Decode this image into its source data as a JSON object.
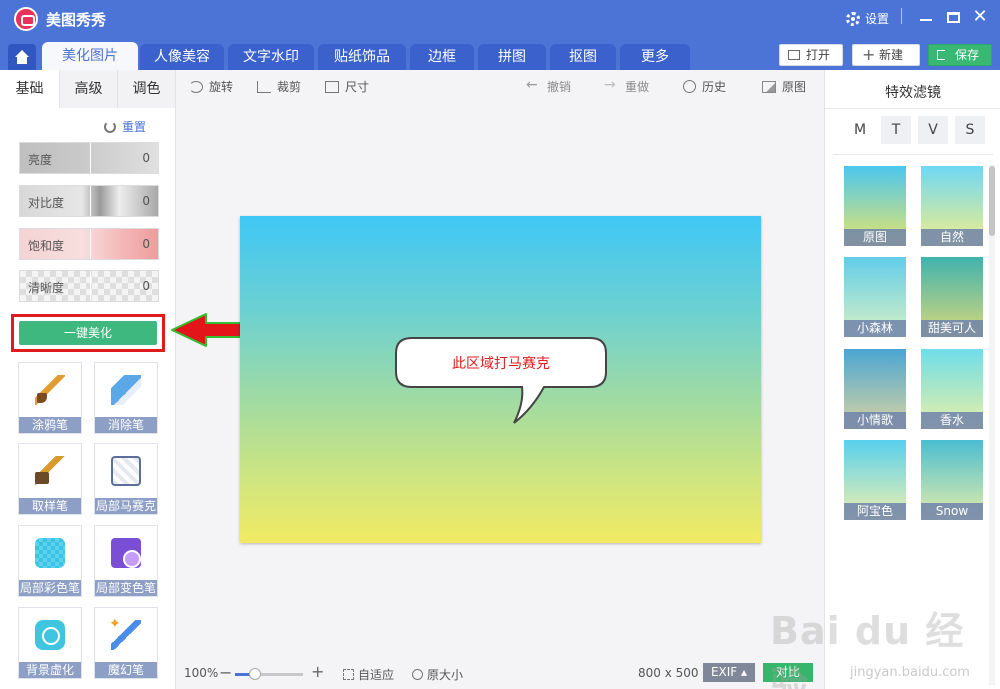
{
  "app": {
    "title": "美图秀秀",
    "settings_label": "设置",
    "close_glyph": "✕"
  },
  "tabs": [
    {
      "label": "美化图片",
      "active": true
    },
    {
      "label": "人像美容"
    },
    {
      "label": "文字水印"
    },
    {
      "label": "贴纸饰品"
    },
    {
      "label": "边框"
    },
    {
      "label": "拼图"
    },
    {
      "label": "抠图"
    },
    {
      "label": "更多"
    }
  ],
  "header_buttons": {
    "open": "打开",
    "new": "新建",
    "save": "保存"
  },
  "left_panel": {
    "subtabs": [
      "基础",
      "高级",
      "调色"
    ],
    "reset_label": "重置",
    "sliders": [
      {
        "label": "亮度",
        "value": "0"
      },
      {
        "label": "对比度",
        "value": "0"
      },
      {
        "label": "饱和度",
        "value": "0"
      },
      {
        "label": "清晰度",
        "value": "0"
      }
    ],
    "one_click_label": "一键美化",
    "tools": [
      {
        "label": "涂鸦笔",
        "icon": "brush-icon"
      },
      {
        "label": "消除笔",
        "icon": "eraser-icon"
      },
      {
        "label": "取样笔",
        "icon": "picker-icon"
      },
      {
        "label": "局部马赛克",
        "icon": "mosaic-icon"
      },
      {
        "label": "局部彩色笔",
        "icon": "color-pen-icon"
      },
      {
        "label": "局部变色笔",
        "icon": "color-change-icon"
      },
      {
        "label": "背景虚化",
        "icon": "blur-icon"
      },
      {
        "label": "魔幻笔",
        "icon": "magic-pen-icon"
      }
    ]
  },
  "toolbar": {
    "rotate": "旋转",
    "crop": "裁剪",
    "size": "尺寸",
    "undo": "撤销",
    "redo": "重做",
    "history": "历史",
    "original": "原图"
  },
  "canvas": {
    "bubble_text": "此区域打马赛克",
    "gradient_top": "#3fc7f5",
    "gradient_bottom": "#f1ea61"
  },
  "footer": {
    "zoom": "100%",
    "zoom_level": 0.3,
    "fit_label": "自适应",
    "actual_label": "原大小",
    "dimensions": "800 x 500",
    "exif_label": "EXIF ▴",
    "compare_label": "对比"
  },
  "right_panel": {
    "title": "特效滤镜",
    "filter_tabs": [
      "M",
      "T",
      "V",
      "S"
    ],
    "filters": [
      {
        "label": "原图",
        "c1": "#4cc6ef",
        "c2": "#e7e56a"
      },
      {
        "label": "自然",
        "c1": "#6fd8f4",
        "c2": "#f2ee88"
      },
      {
        "label": "小森林",
        "c1": "#62cde9",
        "c2": "#d9f1c4"
      },
      {
        "label": "甜美可人",
        "c1": "#3fb3ad",
        "c2": "#d9d87b"
      },
      {
        "label": "小情歌",
        "c1": "#4aa5d3",
        "c2": "#d9d4a1"
      },
      {
        "label": "香水",
        "c1": "#6fdde9",
        "c2": "#e8f0a6"
      },
      {
        "label": "阿宝色",
        "c1": "#58d0ee",
        "c2": "#f0f0ac"
      },
      {
        "label": "Snow",
        "c1": "#4bbdd1",
        "c2": "#e6eea8"
      }
    ]
  },
  "watermark": {
    "text": "Bai du 经验",
    "sub": "jingyan.baidu.com"
  },
  "colors": {
    "brand": "#4c73d6",
    "accent_green": "#3fb880",
    "highlight_red": "#e11b1b"
  }
}
